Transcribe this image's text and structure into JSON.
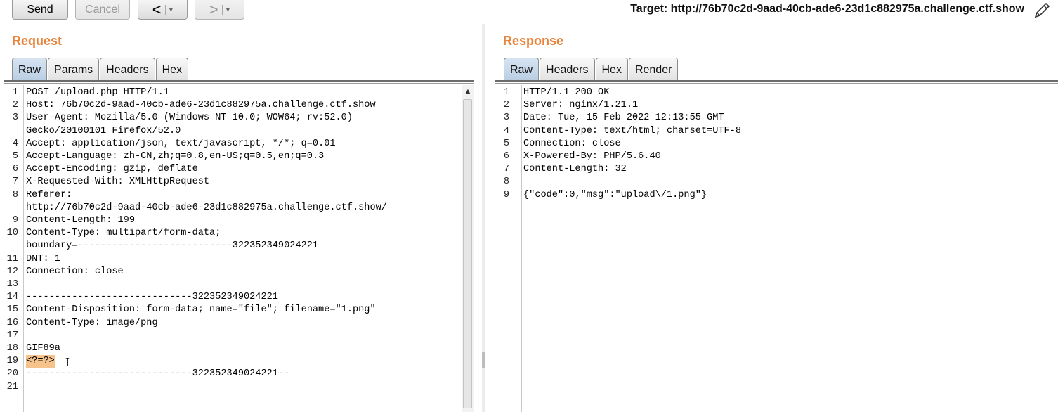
{
  "toolbar": {
    "send_label": "Send",
    "cancel_label": "Cancel",
    "back_arrow": "<",
    "forward_arrow": ">",
    "dropdown_caret": "▾",
    "target_text": "Target: http://76b70c2d-9aad-40cb-ade6-23d1c882975a.challenge.ctf.show",
    "edit_icon": "pencil-icon"
  },
  "request": {
    "title": "Request",
    "tabs": [
      "Raw",
      "Params",
      "Headers",
      "Hex"
    ],
    "active_tab": "Raw",
    "scroll_up_icon": "▲",
    "lines": [
      {
        "num": "1",
        "text": "POST /upload.php HTTP/1.1"
      },
      {
        "num": "2",
        "text": "Host: 76b70c2d-9aad-40cb-ade6-23d1c882975a.challenge.ctf.show"
      },
      {
        "num": "3",
        "text": "User-Agent: Mozilla/5.0 (Windows NT 10.0; WOW64; rv:52.0)"
      },
      {
        "num": "",
        "text": "Gecko/20100101 Firefox/52.0"
      },
      {
        "num": "4",
        "text": "Accept: application/json, text/javascript, */*; q=0.01"
      },
      {
        "num": "5",
        "text": "Accept-Language: zh-CN,zh;q=0.8,en-US;q=0.5,en;q=0.3"
      },
      {
        "num": "6",
        "text": "Accept-Encoding: gzip, deflate"
      },
      {
        "num": "7",
        "text": "X-Requested-With: XMLHttpRequest"
      },
      {
        "num": "8",
        "text": "Referer:"
      },
      {
        "num": "",
        "text": "http://76b70c2d-9aad-40cb-ade6-23d1c882975a.challenge.ctf.show/"
      },
      {
        "num": "9",
        "text": "Content-Length: 199"
      },
      {
        "num": "10",
        "text": "Content-Type: multipart/form-data;"
      },
      {
        "num": "",
        "text": "boundary=---------------------------322352349024221"
      },
      {
        "num": "11",
        "text": "DNT: 1"
      },
      {
        "num": "12",
        "text": "Connection: close"
      },
      {
        "num": "13",
        "text": ""
      },
      {
        "num": "14",
        "text": "-----------------------------322352349024221"
      },
      {
        "num": "15",
        "text": "Content-Disposition: form-data; name=\"file\"; filename=\"1.png\""
      },
      {
        "num": "16",
        "text": "Content-Type: image/png"
      },
      {
        "num": "17",
        "text": ""
      },
      {
        "num": "18",
        "text": "GIF89a"
      },
      {
        "num": "19",
        "text": "<?=?>",
        "highlight": true
      },
      {
        "num": "20",
        "text": "-----------------------------322352349024221--"
      },
      {
        "num": "21",
        "text": ""
      }
    ]
  },
  "response": {
    "title": "Response",
    "tabs": [
      "Raw",
      "Headers",
      "Hex",
      "Render"
    ],
    "active_tab": "Raw",
    "lines": [
      {
        "num": "1",
        "text": "HTTP/1.1 200 OK"
      },
      {
        "num": "2",
        "text": "Server: nginx/1.21.1"
      },
      {
        "num": "3",
        "text": "Date: Tue, 15 Feb 2022 12:13:55 GMT"
      },
      {
        "num": "4",
        "text": "Content-Type: text/html; charset=UTF-8"
      },
      {
        "num": "5",
        "text": "Connection: close"
      },
      {
        "num": "6",
        "text": "X-Powered-By: PHP/5.6.40"
      },
      {
        "num": "7",
        "text": "Content-Length: 32"
      },
      {
        "num": "8",
        "text": ""
      },
      {
        "num": "9",
        "text": "{\"code\":0,\"msg\":\"upload\\/1.png\"}"
      }
    ]
  },
  "colors": {
    "pane_title": "#e8833a",
    "active_tab": "#c5d7ea",
    "highlight": "#f7c38d"
  }
}
